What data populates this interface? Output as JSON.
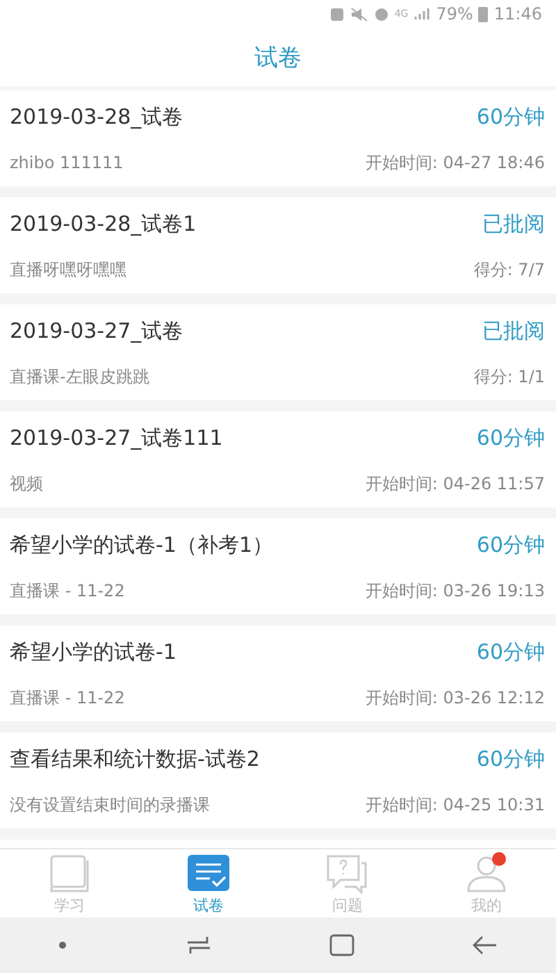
{
  "status_bar": {
    "network": "4G",
    "battery": "79%",
    "time": "11:46"
  },
  "title": "试卷",
  "exams": [
    {
      "name": "2019-03-28_试卷",
      "status": "60分钟",
      "course": "zhibo 111111",
      "info": "开始时间: 04-27 18:46"
    },
    {
      "name": "2019-03-28_试卷1",
      "status": "已批阅",
      "course": "直播呀嘿呀嘿嘿",
      "info": "得分: 7/7"
    },
    {
      "name": "2019-03-27_试卷",
      "status": "已批阅",
      "course": "直播课-左眼皮跳跳",
      "info": "得分: 1/1"
    },
    {
      "name": "2019-03-27_试卷111",
      "status": "60分钟",
      "course": "视频",
      "info": "开始时间: 04-26 11:57"
    },
    {
      "name": "希望小学的试卷-1（补考1）",
      "status": "60分钟",
      "course": "直播课 - 11-22",
      "info": "开始时间: 03-26 19:13"
    },
    {
      "name": "希望小学的试卷-1",
      "status": "60分钟",
      "course": "直播课 - 11-22",
      "info": "开始时间: 03-26 12:12"
    },
    {
      "name": "查看结果和统计数据-试卷2",
      "status": "60分钟",
      "course": "没有设置结束时间的录播课",
      "info": "开始时间: 04-25 10:31"
    }
  ],
  "tabs": [
    {
      "kind": "book",
      "label": "学习",
      "selected": false,
      "badge": false
    },
    {
      "kind": "list",
      "label": "试卷",
      "selected": true,
      "badge": false
    },
    {
      "kind": "question",
      "label": "问题",
      "selected": false,
      "badge": false
    },
    {
      "kind": "person",
      "label": "我的",
      "selected": false,
      "badge": true
    }
  ]
}
